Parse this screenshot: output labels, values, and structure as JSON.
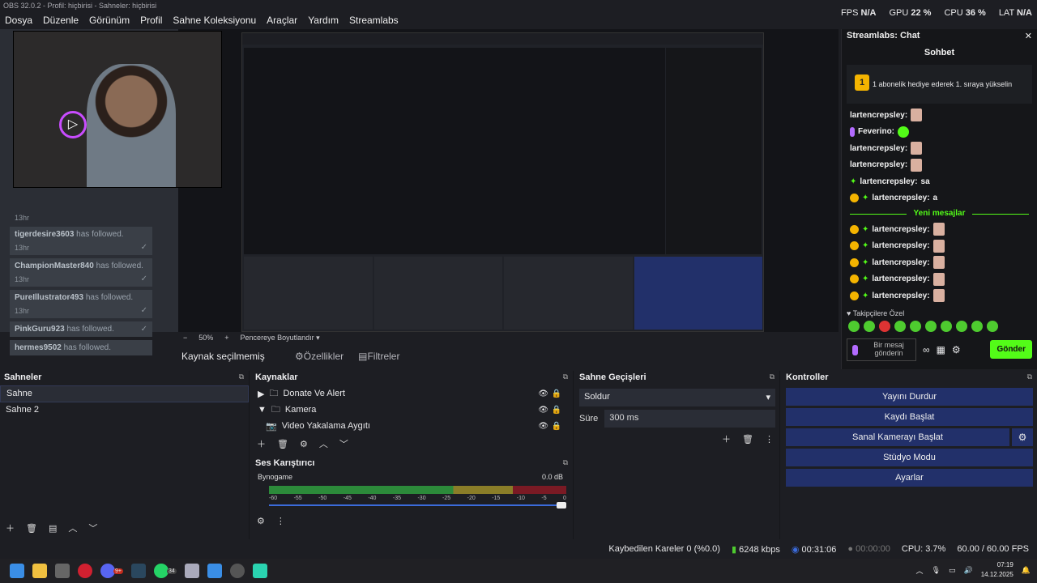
{
  "window": {
    "title": "OBS 32.0.2 - Profil: hiçbirisi - Sahneler: hiçbirisi"
  },
  "menu": [
    "Dosya",
    "Düzenle",
    "Görünüm",
    "Profil",
    "Sahne Koleksiyonu",
    "Araçlar",
    "Yardım",
    "Streamlabs"
  ],
  "stats": {
    "fps_label": "FPS",
    "fps": "N/A",
    "gpu_label": "GPU",
    "gpu": "22 %",
    "cpu_label": "CPU",
    "cpu": "36 %",
    "lat_label": "LAT",
    "lat": "N/A"
  },
  "follow_feed": [
    {
      "name": "tigerdesire3603",
      "text": "has followed.",
      "time": "13hr"
    },
    {
      "name": "ChampionMaster840",
      "text": "has followed.",
      "time": "13hr"
    },
    {
      "name": "PureIllustrator493",
      "text": "has followed.",
      "time": "13hr"
    },
    {
      "name": "PinkGuru923",
      "text": "has followed.",
      "time": ""
    },
    {
      "name": "hermes9502",
      "text": "has followed.",
      "time": ""
    }
  ],
  "feed_top_time": "13hr",
  "preview_bottom": {
    "zoom_minus": "−",
    "zoom": "50%",
    "zoom_plus": "+",
    "resize": "Pencereye Boyutlandır"
  },
  "source_bar": {
    "label": "Kaynak seçilmemiş",
    "properties": "Özellikler",
    "filters": "Filtreler"
  },
  "chat": {
    "title": "Streamlabs: Chat",
    "tab": "Sohbet",
    "pin_badge": "1",
    "pin_text": "1 abonelik hediye ederek 1. sıraya yükselin",
    "messages_top": [
      {
        "user": "lartencrepsley:",
        "type": "emote"
      },
      {
        "user": "Feverino:",
        "type": "green"
      },
      {
        "user": "lartencrepsley:",
        "type": "emote"
      },
      {
        "user": "lartencrepsley:",
        "type": "emote"
      },
      {
        "user": "lartencrepsley:",
        "type": "text",
        "text": "sa"
      },
      {
        "user": "lartencrepsley:",
        "type": "text",
        "text": "a"
      }
    ],
    "new_messages": "Yeni mesajlar",
    "messages_new": [
      "lartencrepsley:",
      "lartencrepsley:",
      "lartencrepsley:",
      "lartencrepsley:",
      "lartencrepsley:"
    ],
    "follower_special": "Takipçilere Özel",
    "input_placeholder": "Bir mesaj gönderin",
    "send": "Gönder"
  },
  "scenes": {
    "title": "Sahneler",
    "items": [
      "Sahne",
      "Sahne 2"
    ]
  },
  "sources": {
    "title": "Kaynaklar",
    "items": [
      {
        "label": "Donate Ve Alert",
        "arrow": "▶",
        "kind": "folder"
      },
      {
        "label": "Kamera",
        "arrow": "▼",
        "kind": "folder"
      },
      {
        "label": "Video Yakalama Aygıtı",
        "arrow": "",
        "kind": "camera"
      }
    ]
  },
  "mixer": {
    "title": "Ses Karıştırıcı",
    "channel": "Bynogame",
    "db": "0.0 dB",
    "scale": [
      "-60",
      "-55",
      "-50",
      "-45",
      "-40",
      "-35",
      "-30",
      "-25",
      "-20",
      "-15",
      "-10",
      "-5",
      "0"
    ]
  },
  "transitions": {
    "title": "Sahne Geçişleri",
    "selected": "Soldur",
    "duration_label": "Süre",
    "duration": "300 ms"
  },
  "controls": {
    "title": "Kontroller",
    "stop_stream": "Yayını Durdur",
    "start_record": "Kaydı Başlat",
    "virtual_cam": "Sanal Kamerayı Başlat",
    "studio": "Stüdyo Modu",
    "settings": "Ayarlar"
  },
  "statusbar": {
    "dropped": "Kaybedilen Kareler 0 (%0.0)",
    "bitrate": "6248 kbps",
    "stream_time": "00:31:06",
    "rec_time": "00:00:00",
    "cpu": "CPU: 3.7%",
    "fps": "60.00 / 60.00 FPS"
  },
  "taskbar": {
    "time": "07:19",
    "date": "14.12.2025",
    "badge1": "9+",
    "badge2": "34"
  }
}
